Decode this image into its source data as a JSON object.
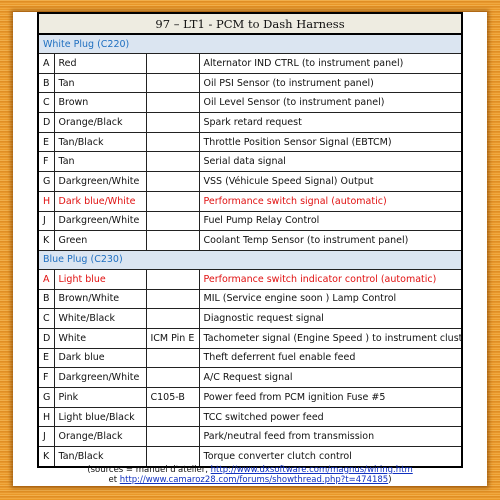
{
  "title": "97 – LT1 - PCM to Dash Harness",
  "sections": [
    {
      "header": "White Plug (C220)",
      "rows": [
        [
          "A",
          "Red",
          "",
          "Alternator IND CTRL (to instrument panel)"
        ],
        [
          "B",
          "Tan",
          "",
          "Oil PSI Sensor (to instrument panel)"
        ],
        [
          "C",
          "Brown",
          "",
          "Oil Level Sensor (to instrument panel)"
        ],
        [
          "D",
          "Orange/Black",
          "",
          "Spark retard request"
        ],
        [
          "E",
          "Tan/Black",
          "",
          "Throttle Position Sensor Signal (EBTCM)"
        ],
        [
          "F",
          "Tan",
          "",
          "Serial data signal"
        ],
        [
          "G",
          "Darkgreen/White",
          "",
          "VSS (Véhicule Speed Signal) Output"
        ],
        [
          "H",
          "Dark blue/White",
          "",
          "Performance switch signal (automatic)"
        ],
        [
          "J",
          "Darkgreen/White",
          "",
          "Fuel Pump Relay Control"
        ],
        [
          "K",
          "Green",
          "",
          "Coolant Temp Sensor (to instrument panel)"
        ]
      ]
    },
    {
      "header": "Blue Plug (C230)",
      "rows": [
        [
          "A",
          "Light blue",
          "",
          "Performance switch indicator control (automatic)"
        ],
        [
          "B",
          "Brown/White",
          "",
          "MIL (Service engine soon ) Lamp Control"
        ],
        [
          "C",
          "White/Black",
          "",
          "Diagnostic request signal"
        ],
        [
          "D",
          "White",
          "ICM Pin E",
          "Tachometer signal (Engine Speed ) to instrument cluster"
        ],
        [
          "E",
          "Dark blue",
          "",
          "Theft deferrent fuel enable feed"
        ],
        [
          "F",
          "Darkgreen/White",
          "",
          "A/C Request signal"
        ],
        [
          "G",
          "Pink",
          "C105-B",
          "Power feed from PCM ignition Fuse #5"
        ],
        [
          "H",
          "Light blue/Black",
          "",
          "TCC switched power feed"
        ],
        [
          "J",
          "Orange/Black",
          "",
          "Park/neutral feed from transmission"
        ],
        [
          "K",
          "Tan/Black",
          "",
          "Torque converter clutch control"
        ]
      ]
    }
  ],
  "highlight_color": "#e01010",
  "highlighted": {
    "0": [
      7
    ],
    "1": [
      0
    ]
  },
  "footer": {
    "prefix": "(sources = manuel d'atelier, ",
    "link1": "http://www.dxsoftware.com/magnus/wiring.htm",
    "mid": "et ",
    "link2": "http://www.camaroz28.com/forums/showthread.php?t=474185",
    "suffix": ")"
  }
}
